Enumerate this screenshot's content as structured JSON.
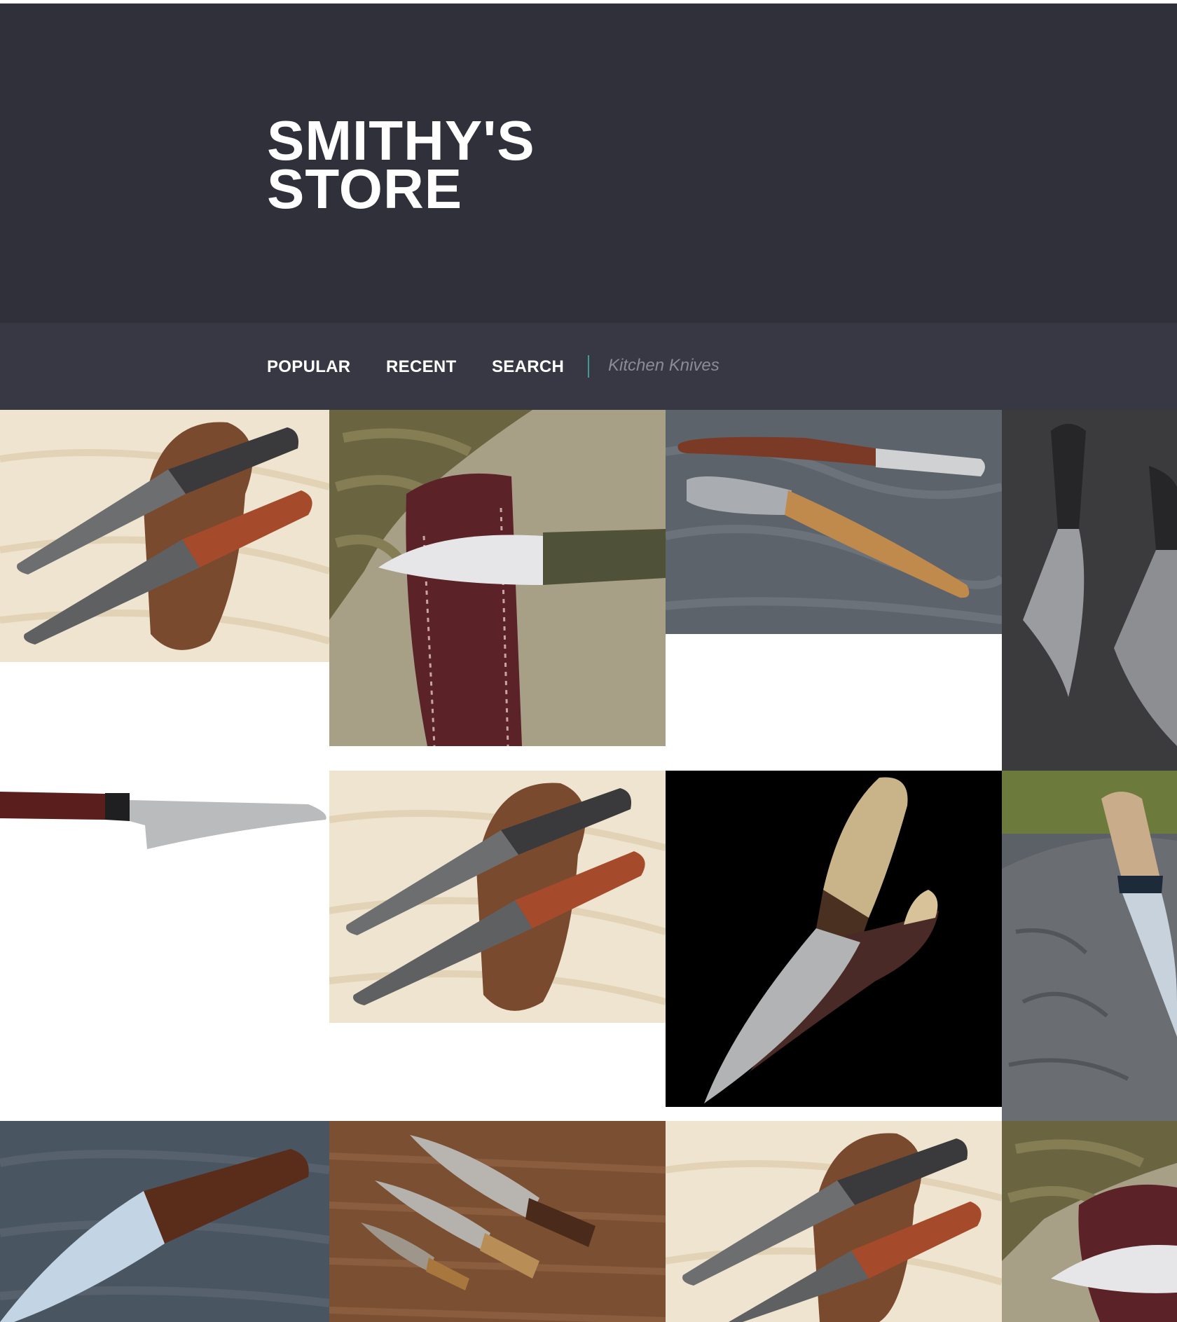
{
  "store": {
    "title_line1": "SMITHY'S",
    "title_line2": "STORE"
  },
  "nav": {
    "items": [
      {
        "label": "POPULAR"
      },
      {
        "label": "RECENT"
      },
      {
        "label": "SEARCH"
      }
    ],
    "search_placeholder": "Kitchen Knives"
  },
  "colors": {
    "header_bg": "#30303b",
    "nav_bg": "#373844",
    "divider_accent": "#3e9a92",
    "page_bg": "#ffffff"
  },
  "gallery": {
    "tiles": [
      {
        "icon": "two-knives-leather-sheath-icon"
      },
      {
        "icon": "knife-paracord-sheath-icon"
      },
      {
        "icon": "two-spreaders-slate-icon"
      },
      {
        "icon": "railroad-spike-knives-icon"
      },
      {
        "icon": "santoku-knife-icon"
      },
      {
        "icon": "two-knives-leather-sheath-icon"
      },
      {
        "icon": "puukko-knife-black-icon"
      },
      {
        "icon": "knife-tree-stump-icon"
      },
      {
        "icon": "chef-knife-stone-icon"
      },
      {
        "icon": "damascus-knife-set-icon"
      },
      {
        "icon": "two-knives-leather-sheath-icon"
      },
      {
        "icon": "knife-paracord-sheath-icon"
      }
    ]
  }
}
